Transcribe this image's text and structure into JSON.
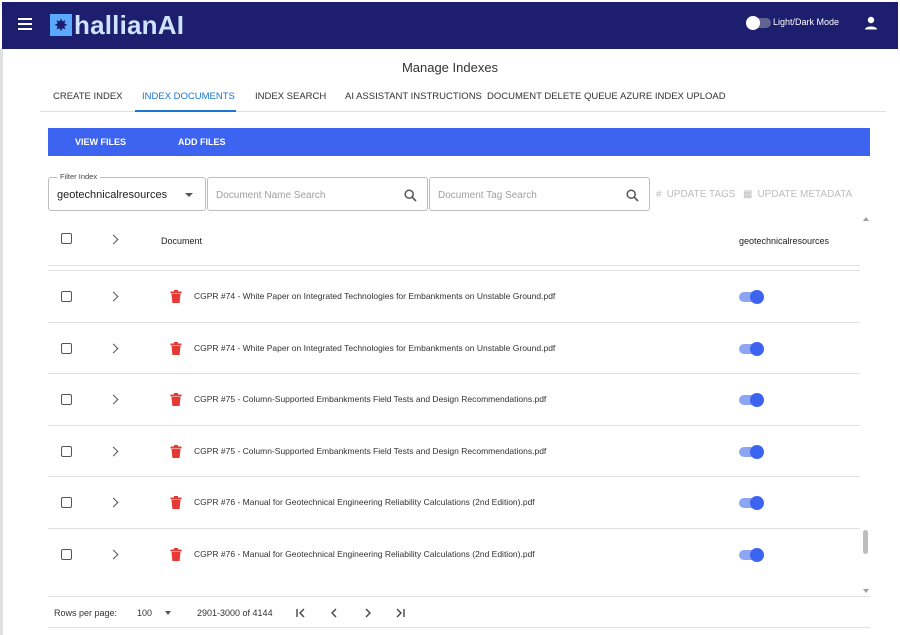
{
  "app": {
    "brand": "hallianAI",
    "logo_glyph": "✸",
    "mode_label": "Light/Dark Mode"
  },
  "page": {
    "title": "Manage Indexes"
  },
  "tabs": [
    {
      "label": "CREATE INDEX",
      "active": false
    },
    {
      "label": "INDEX DOCUMENTS",
      "active": true
    },
    {
      "label": "INDEX SEARCH",
      "active": false
    },
    {
      "label": "AI ASSISTANT INSTRUCTIONS",
      "active": false
    },
    {
      "label": "DOCUMENT DELETE QUEUE",
      "active": false
    },
    {
      "label": "AZURE INDEX UPLOAD",
      "active": false
    }
  ],
  "subbar": {
    "view_files": "VIEW FILES",
    "add_files": "ADD FILES"
  },
  "filter": {
    "label": "Filter Index",
    "value": "geotechnicalresources"
  },
  "search": {
    "name_placeholder": "Document Name Search",
    "name_value": "",
    "tag_placeholder": "Document Tag Search",
    "tag_value": ""
  },
  "actions": {
    "update_tags": "UPDATE TAGS",
    "update_metadata": "UPDATE METADATA",
    "update_tags_glyph": "#",
    "update_metadata_glyph": "▦"
  },
  "table": {
    "col_document": "Document",
    "col_index": "geotechnicalresources",
    "rows": [
      {
        "name": "CGPR #74 - White Paper on Integrated Technologies for Embankments on Unstable Ground.pdf",
        "enabled": true
      },
      {
        "name": "CGPR #74 - White Paper on Integrated Technologies for Embankments on Unstable Ground.pdf",
        "enabled": true
      },
      {
        "name": "CGPR #75 - Column-Supported Embankments Field Tests and Design Recommendations.pdf",
        "enabled": true
      },
      {
        "name": "CGPR #75 - Column-Supported Embankments Field Tests and Design Recommendations.pdf",
        "enabled": true
      },
      {
        "name": "CGPR #76 - Manual for Geotechnical Engineering Reliability Calculations (2nd Edition).pdf",
        "enabled": true
      },
      {
        "name": "CGPR #76 - Manual for Geotechnical Engineering Reliability Calculations (2nd Edition).pdf",
        "enabled": true
      }
    ]
  },
  "pagination": {
    "rows_per_page_label": "Rows per page:",
    "rows_per_page": "100",
    "range": "2901-3000 of 4144"
  },
  "colors": {
    "appbar": "#1d1f6e",
    "accent": "#3d64f0",
    "tab_active": "#1976d2",
    "trash": "#e53935"
  }
}
